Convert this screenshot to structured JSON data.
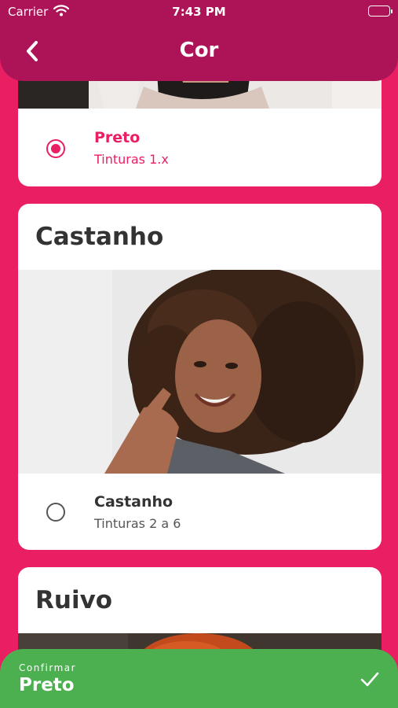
{
  "status_bar": {
    "carrier": "Carrier",
    "time": "7:43 PM"
  },
  "header": {
    "title": "Cor",
    "back_icon": "chevron-left-icon"
  },
  "options": [
    {
      "title": "",
      "name": "Preto",
      "subtitle": "Tinturas 1.x",
      "selected": true
    },
    {
      "title": "Castanho",
      "name": "Castanho",
      "subtitle": "Tinturas 2 a 6",
      "selected": false
    },
    {
      "title": "Ruivo"
    }
  ],
  "confirm": {
    "label": "Confirmar",
    "value": "Preto",
    "icon": "check-icon"
  },
  "colors": {
    "background": "#e91e63",
    "header": "#ad1457",
    "confirm": "#4caf50",
    "accent": "#e91e63"
  }
}
